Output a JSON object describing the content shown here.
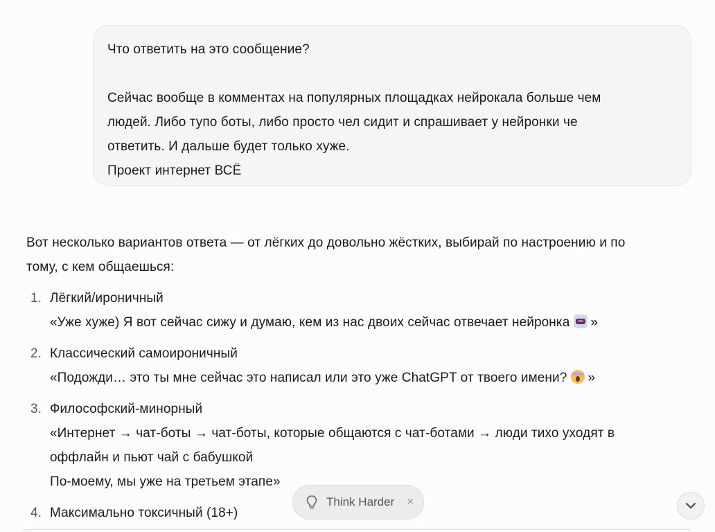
{
  "user_message": {
    "line1": "Что ответить на это сообщение?",
    "line2": "Сейчас вообще в комментах на популярных площадках нейрокала больше чем",
    "line3": "людей. Либо тупо боты, либо просто чел сидит и спрашивает у нейронки че",
    "line4": "ответить. И дальше будет только хуже.",
    "line5": "Проект интернет ВСЁ"
  },
  "assistant": {
    "intro_line1": "Вот несколько вариантов ответа — от лёгких до довольно жёстких, выбирай по настроению и по",
    "intro_line2": "тому, с кем общаешься:",
    "items": [
      {
        "number": "1.",
        "title": "Лёгкий/ироничный",
        "text": "«Уже хуже) Я вот сейчас сижу и думаю, кем из нас двоих сейчас отвечает нейронка",
        "closing": "»",
        "emoji": "robot-icon"
      },
      {
        "number": "2.",
        "title": "Классический самоироничный",
        "text": "«Подожди… это ты мне сейчас это написал или это уже ChatGPT от твоего имени?",
        "closing": "»",
        "emoji": "scream-icon"
      },
      {
        "number": "3.",
        "title": "Философский-минорный",
        "text_line1": "«Интернет → чат-боты → чат-боты, которые общаются с чат-ботами → люди тихо уходят в",
        "text_line2": "оффлайн и пьют чай с бабушкой",
        "text_line3": "По-моему, мы уже на третьем этапе»"
      },
      {
        "number": "4.",
        "title": "Максимально токсичный (18+)"
      }
    ]
  },
  "think_pill": {
    "label": "Think Harder",
    "close": "×",
    "icon": "lightbulb-icon"
  },
  "scroll_button": {
    "icon": "chevron-down-icon"
  }
}
